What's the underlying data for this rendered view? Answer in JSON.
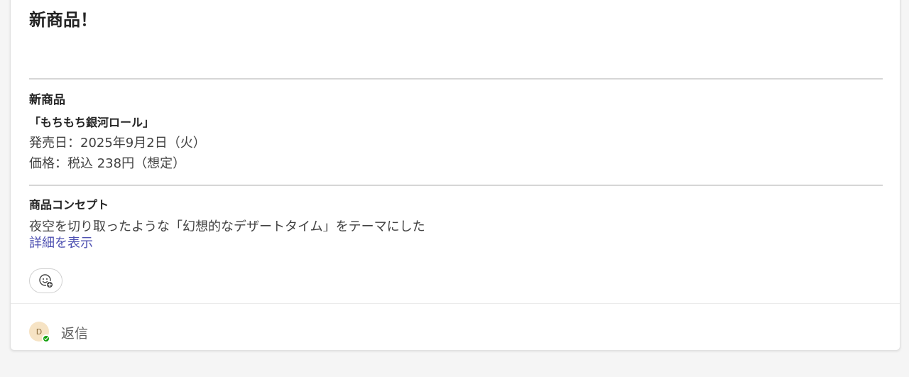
{
  "post": {
    "title": "新商品！",
    "section1": {
      "heading": "新商品",
      "product_name": "「もちもち銀河ロール」",
      "release_date": "発売日：2025年9月2日（火）",
      "price": "価格：税込 238円（想定）"
    },
    "section2": {
      "heading": "商品コンセプト",
      "preview_text": "夜空を切り取ったような「幻想的なデザートタイム」をテーマにした",
      "show_more_label": "詳細を表示"
    },
    "reaction_button": {
      "icon": "emoji-add-icon"
    }
  },
  "footer": {
    "avatar_initial": "D",
    "presence_status": "available",
    "reply_label": "返信"
  },
  "colors": {
    "link": "#4f52b2",
    "presence_available": "#13a10e",
    "avatar_bg": "#f6e3c4"
  }
}
